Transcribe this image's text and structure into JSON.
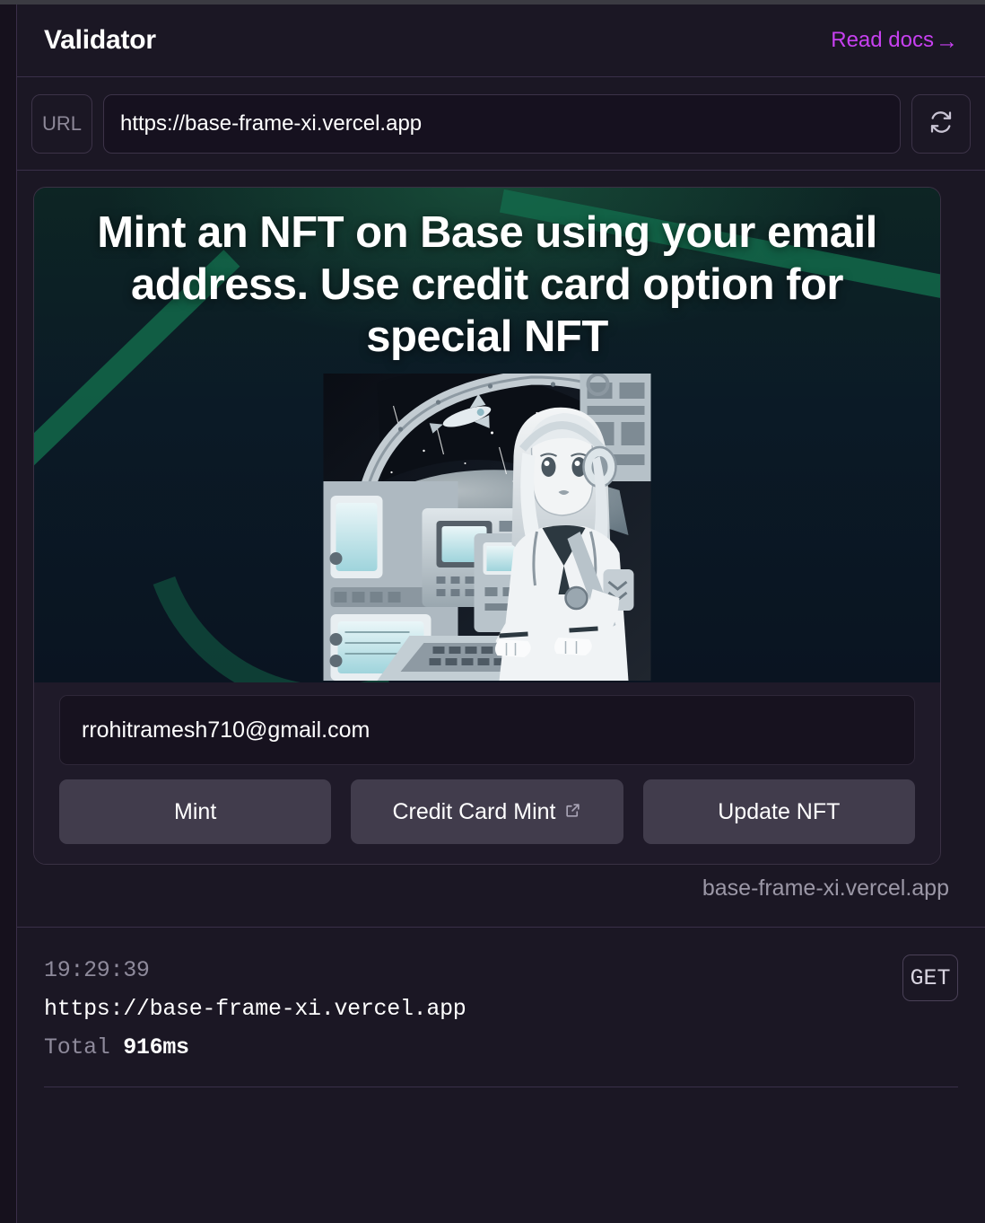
{
  "header": {
    "title": "Validator",
    "docs_link": "Read docs",
    "docs_arrow": "→"
  },
  "urlbar": {
    "tag": "URL",
    "value": "https://base-frame-xi.vercel.app",
    "placeholder": "https://",
    "refresh_icon": "refresh-icon"
  },
  "frame": {
    "heading": "Mint an NFT on Base using your email address. Use credit card option for special NFT",
    "image_alt": "anime girl with headphones at space station console",
    "input_value": "rrohitramesh710@gmail.com",
    "input_placeholder": "Enter email",
    "buttons": [
      {
        "label": "Mint",
        "external": false
      },
      {
        "label": "Credit Card Mint",
        "external": true
      },
      {
        "label": "Update NFT",
        "external": false
      }
    ],
    "domain": "base-frame-xi.vercel.app"
  },
  "log": {
    "time": "19:29:39",
    "url": "https://base-frame-xi.vercel.app",
    "total_label": "Total",
    "total_value": "916ms",
    "method": "GET"
  },
  "colors": {
    "page_bg": "#17131f",
    "panel_bg": "#1b1724",
    "border": "#3a2f49",
    "accent": "#c740f0",
    "text": "#ffffff",
    "muted": "#8e8a9b",
    "button_bg": "#413c4c",
    "frame_green": "#13694a"
  }
}
